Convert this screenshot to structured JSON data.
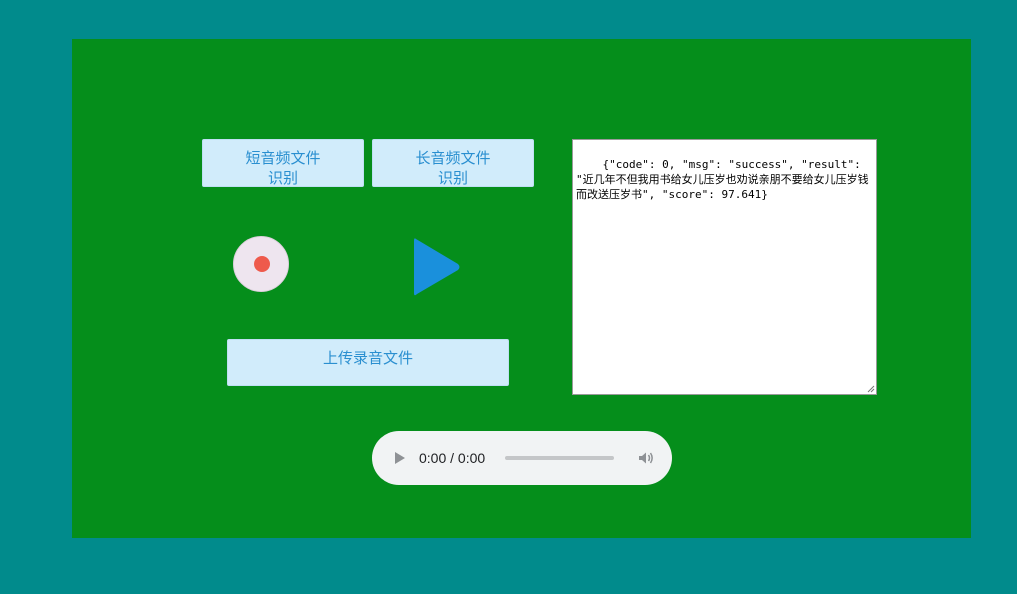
{
  "buttons": {
    "short_audio": {
      "line1": "短音频文件",
      "line2": "识别"
    },
    "long_audio": {
      "line1": "长音频文件",
      "line2": "识别"
    },
    "upload": "上传录音文件"
  },
  "icons": {
    "record": "record-icon",
    "play": "play-icon"
  },
  "result_text": "{\"code\": 0, \"msg\": \"success\", \"result\": \"近几年不但我用书给女儿压岁也劝说亲朋不要给女儿压岁钱而改送压岁书\", \"score\": 97.641}",
  "audio_player": {
    "time": "0:00 / 0:00",
    "progress": 0
  },
  "colors": {
    "page_background": "#018b8c",
    "panel_background": "#058e1b",
    "button_background": "#d1ecfb",
    "button_text": "#2a8fd0",
    "record_dot": "#ee5a4c",
    "play_icon": "#1a90dc"
  }
}
